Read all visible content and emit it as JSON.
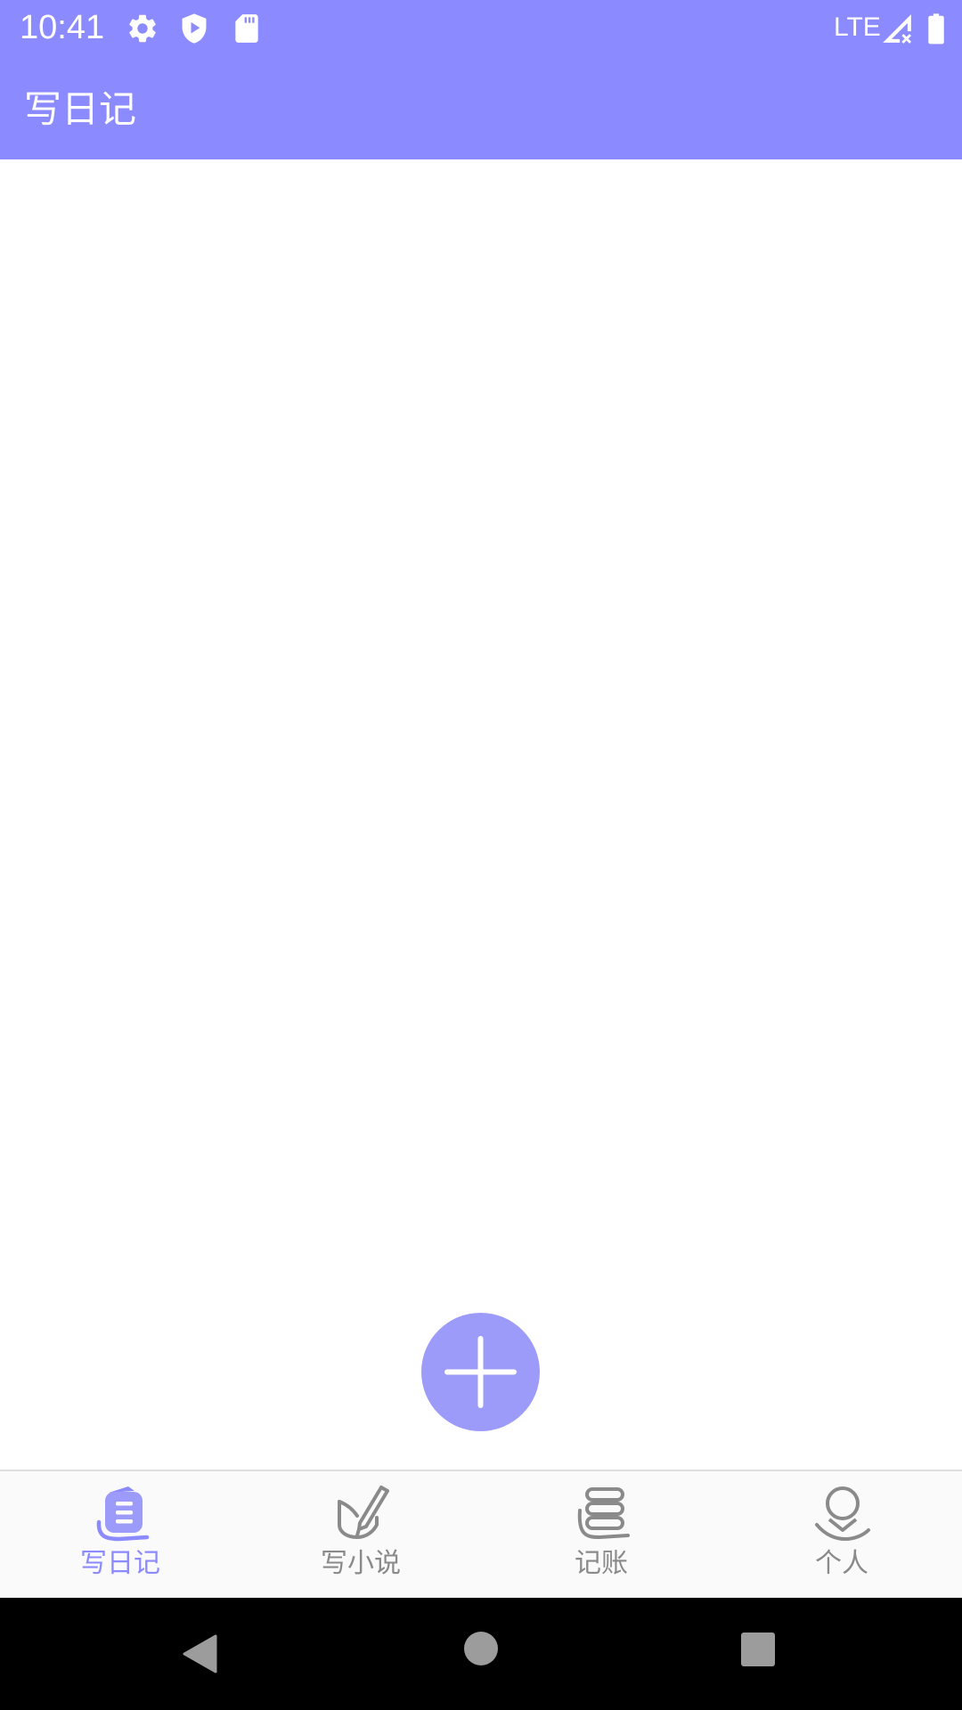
{
  "status_bar": {
    "time": "10:41",
    "network": "LTE",
    "icons": [
      "gear-icon",
      "shield-play-icon",
      "sd-card-icon",
      "signal-no-data-icon",
      "battery-icon"
    ]
  },
  "app_bar": {
    "title": "写日记"
  },
  "fab": {
    "icon": "plus-icon"
  },
  "bottom_nav": {
    "items": [
      {
        "label": "写日记",
        "icon": "diary-book-icon",
        "active": true
      },
      {
        "label": "写小说",
        "icon": "open-book-pen-icon",
        "active": false
      },
      {
        "label": "记账",
        "icon": "coin-stack-icon",
        "active": false
      },
      {
        "label": "个人",
        "icon": "person-icon",
        "active": false
      }
    ]
  },
  "system_nav": {
    "buttons": [
      "back-icon",
      "home-icon",
      "recents-icon"
    ]
  },
  "colors": {
    "primary": "#8c8aff",
    "fab": "#9d9bfa",
    "inactive": "#8a8a8a",
    "nav_background": "#fafafa",
    "system_bar": "#000000"
  }
}
